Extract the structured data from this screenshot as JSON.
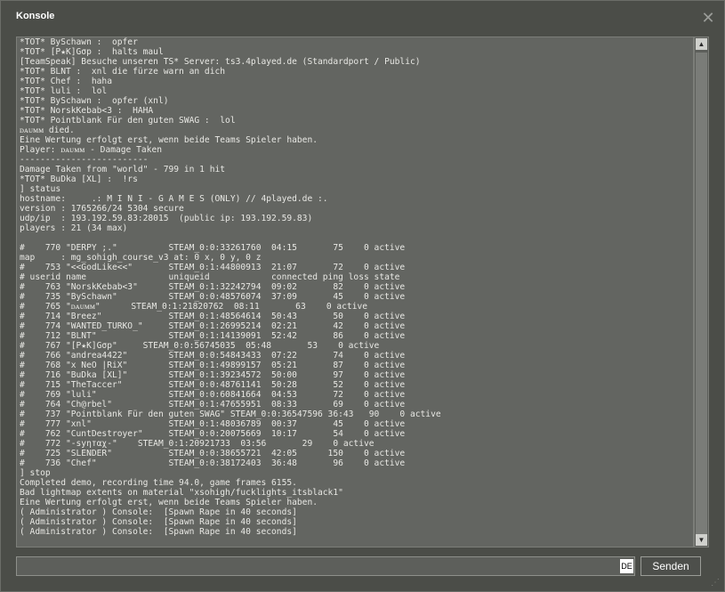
{
  "window": {
    "title": "Konsole",
    "close_glyph": "✕"
  },
  "console": {
    "lines": [
      "*TOT* BySchawn :  opfer",
      "*TOT* [P★K]Gσp :  halts maul",
      "[TeamSpeak] Besuche unseren TS* Server: ts3.4played.de (Standardport / Public)",
      "*TOT* BLNT :  xnl die fürze warn an dich",
      "*TOT* Chef :  haha",
      "*TOT* luli :  lol",
      "*TOT* BySchawn :  opfer (xnl)",
      "*TOT* NorskKebab<3 :  HAHA",
      "*TOT* Pointblank Für den guten SWAG :  lol",
      "ᴅᴀᴜᴍᴍ died.",
      "Eine Wertung erfolgt erst, wenn beide Teams Spieler haben.",
      "Player: ᴅᴀᴜᴍᴍ - Damage Taken",
      "-------------------------",
      "Damage Taken from \"world\" - 799 in 1 hit",
      "*TOT* BuDka [XL] :  !rs",
      "] status",
      "hostname:     .: M I N I - G A M E S (ONLY) // 4played.de :.",
      "version : 1765266/24 5304 secure",
      "udp/ip  : 193.192.59.83:28015  (public ip: 193.192.59.83)",
      "players : 21 (34 max)",
      "",
      "#    770 \"DERPY ;.\"          STEAM_0:0:33261760  04:15       75    0 active",
      "map     : mg_sohigh_course_v3 at: 0 x, 0 y, 0 z",
      "#    753 \"<<GodLike<<\"       STEAM_0:1:44800913  21:07       72    0 active",
      "# userid name                uniqueid            connected ping loss state",
      "#    763 \"NorskKebab<3\"      STEAM_0:1:32242794  09:02       82    0 active",
      "#    735 \"BySchawn\"          STEAM_0:0:48576074  37:09       45    0 active",
      "#    765 \"ᴅᴀᴜᴍᴍ\"      STEAM_0:1:21820762  08:11       63    0 active",
      "#    714 \"Breez\"             STEAM_0:1:48564614  50:43       50    0 active",
      "#    774 \"WANTED_TURKO_\"     STEAM_0:1:26995214  02:21       42    0 active",
      "#    712 \"BLNT\"              STEAM_0:1:14139091  52:42       86    0 active",
      "#    767 \"[P★K]Gσp\"     STEAM_0:0:56745035  05:48       53    0 active",
      "#    766 \"andrea4422\"        STEAM_0:0:54843433  07:22       74    0 active",
      "#    768 \"x NeO |RiX\"        STEAM_0:1:49899157  05:21       87    0 active",
      "#    716 \"BuDka [XL]\"        STEAM_0:1:39234572  50:00       97    0 active",
      "#    715 \"TheTaccer\"         STEAM_0:0:48761141  50:28       52    0 active",
      "#    769 \"luli\"              STEAM_0:0:60841664  04:53       72    0 active",
      "#    764 \"Ch@rbel\"           STEAM_0:1:47655951  08:33       69    0 active",
      "#    737 \"Pointblank Für den guten SWAG\" STEAM_0:0:36547596 36:43   90    0 active",
      "#    777 \"xnl\"               STEAM_0:1:48036789  00:37       45    0 active",
      "#    762 \"CuntDestroyer\"     STEAM_0:0:20075669  10:17       54    0 active",
      "#    772 \"-ѕуηтαχ-\"    STEAM_0:1:20921733  03:56       29    0 active",
      "#    725 \"SLENDER\"           STEAM_0:0:38655721  42:05      150    0 active",
      "#    736 \"Chef\"              STEAM_0:0:38172403  36:48       96    0 active",
      "] stop",
      "Completed demo, recording time 94.0, game frames 6155.",
      "Bad lightmap extents on material \"xsohigh/fucklights_itsblack1\"",
      "Eine Wertung erfolgt erst, wenn beide Teams Spieler haben.",
      "( Administrator ) Console:  [Spawn Rape in 40 seconds]",
      "( Administrator ) Console:  [Spawn Rape in 40 seconds]",
      "( Administrator ) Console:  [Spawn Rape in 40 seconds]"
    ]
  },
  "scrollbar": {
    "up_glyph": "▲",
    "down_glyph": "▼",
    "position_fraction": 1.0
  },
  "input": {
    "value": "",
    "language_badge": "DE"
  },
  "send_button": {
    "label": "Senden"
  },
  "resize_grip_glyph": "⋰"
}
